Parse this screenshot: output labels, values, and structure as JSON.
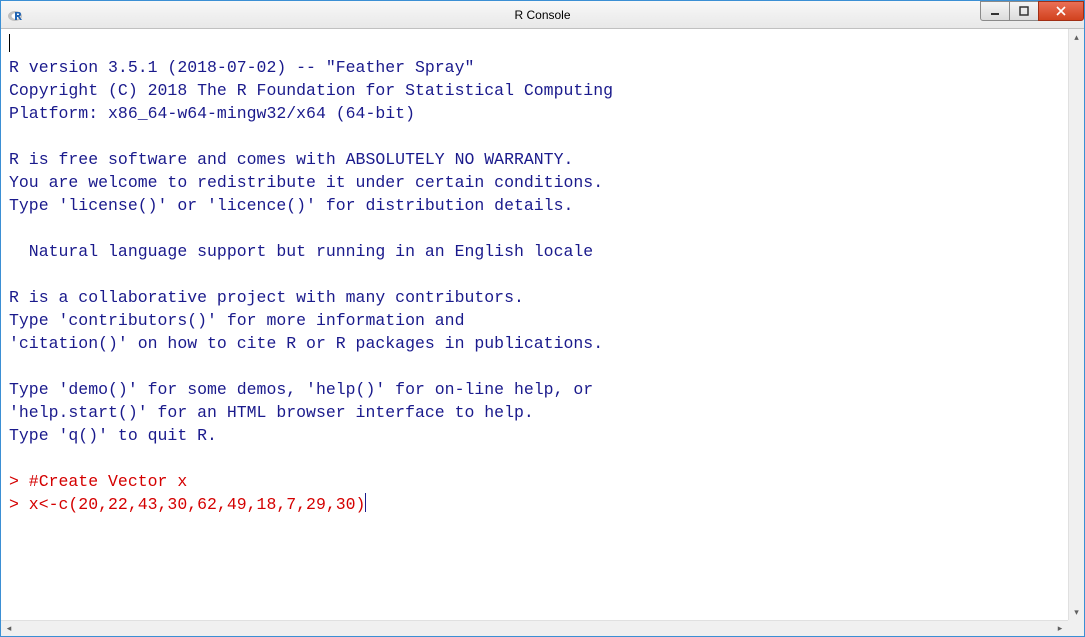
{
  "window": {
    "title": "R Console"
  },
  "console": {
    "lines": [
      "",
      "R version 3.5.1 (2018-07-02) -- \"Feather Spray\"",
      "Copyright (C) 2018 The R Foundation for Statistical Computing",
      "Platform: x86_64-w64-mingw32/x64 (64-bit)",
      "",
      "R is free software and comes with ABSOLUTELY NO WARRANTY.",
      "You are welcome to redistribute it under certain conditions.",
      "Type 'license()' or 'licence()' for distribution details.",
      "",
      "  Natural language support but running in an English locale",
      "",
      "R is a collaborative project with many contributors.",
      "Type 'contributors()' for more information and",
      "'citation()' on how to cite R or R packages in publications.",
      "",
      "Type 'demo()' for some demos, 'help()' for on-line help, or",
      "'help.start()' for an HTML browser interface to help.",
      "Type 'q()' to quit R.",
      ""
    ],
    "input_lines": [
      "> #Create Vector x",
      "> x<-c(20,22,43,30,62,49,18,7,29,30)"
    ]
  }
}
